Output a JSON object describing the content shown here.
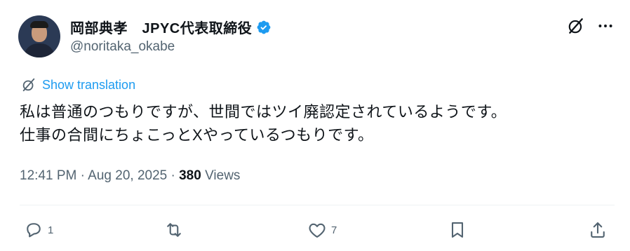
{
  "author": {
    "display_name": "岡部典孝　JPYC代表取締役",
    "handle": "@noritaka_okabe",
    "verified": true
  },
  "translation": {
    "label": "Show translation"
  },
  "tweet": {
    "lines": [
      "私は普通のつもりですが、世間ではツイ廃認定されているようです。",
      "仕事の合間にちょこっとXやっているつもりです。"
    ]
  },
  "meta": {
    "time": "12:41 PM",
    "date": "Aug 20, 2025",
    "views_count": "380",
    "views_label": "Views"
  },
  "actions": {
    "reply_count": "1",
    "retweet_count": "",
    "like_count": "7"
  },
  "colors": {
    "accent": "#1d9bf0",
    "secondary_text": "#536471",
    "primary_text": "#0f1419"
  },
  "icons": [
    "verified-badge-icon",
    "grok-icon",
    "more-icon",
    "translate-icon",
    "reply-icon",
    "retweet-icon",
    "like-icon",
    "bookmark-icon",
    "share-icon"
  ]
}
